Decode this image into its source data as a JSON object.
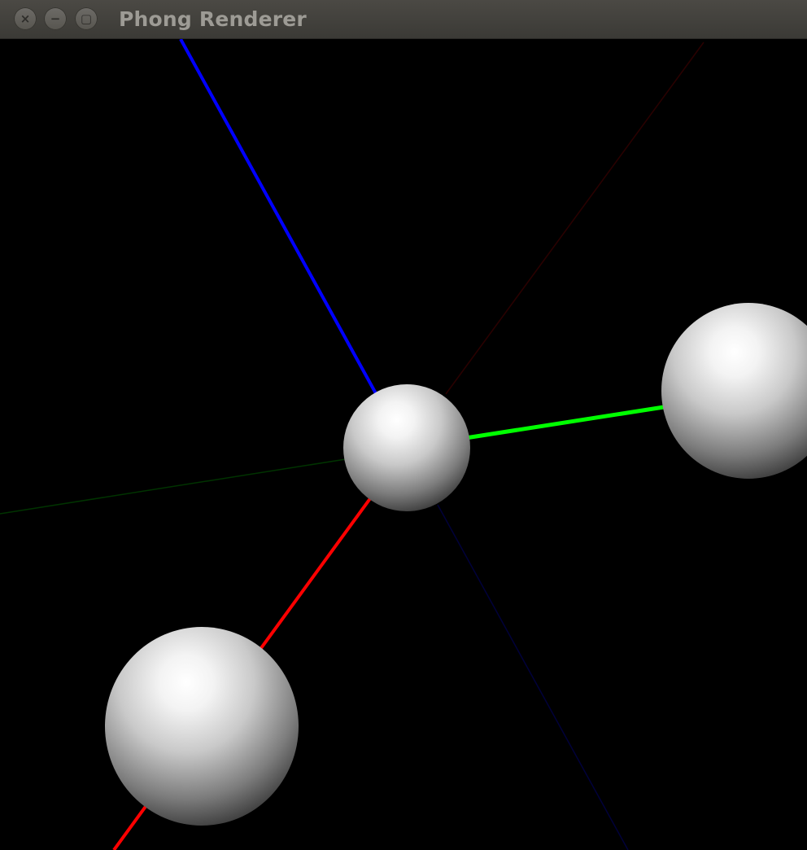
{
  "window": {
    "title": "Phong Renderer",
    "buttons": {
      "close_icon": "close-icon",
      "minimize_icon": "minimize-icon",
      "maximize_icon": "maximize-icon",
      "close_glyph": "×",
      "minimize_glyph": "−",
      "maximize_glyph": "▢"
    }
  },
  "scene": {
    "background_color": "#000000",
    "axes": {
      "x_positive_color": "#ff0000",
      "x_negative_color": "#2a0000",
      "y_positive_color": "#00ff00",
      "y_negative_color": "#003300",
      "z_positive_color": "#0000ff",
      "z_negative_color": "#00003a"
    },
    "spheres": [
      {
        "name": "origin-sphere",
        "color": "#ffffff"
      },
      {
        "name": "x-axis-sphere",
        "color": "#ffffff"
      },
      {
        "name": "y-axis-sphere",
        "color": "#ffffff"
      }
    ]
  }
}
